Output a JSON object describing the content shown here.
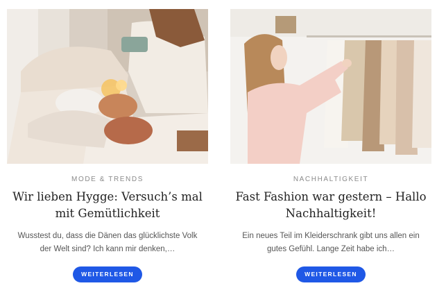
{
  "posts": [
    {
      "category": "Mode & Trends",
      "title": "Wir lieben Hygge: Versuch’s mal mit Gemütlichkeit",
      "excerpt": "Wusstest du, dass die Dänen das glücklichste Volk der Welt sind? Ich kann mir denken,…",
      "button": "Weiterlesen"
    },
    {
      "category": "Nachhaltigkeit",
      "title": "Fast Fashion war gestern – Hallo Nachhaltigkeit!",
      "excerpt": "Ein neues Teil im Kleiderschrank gibt uns allen ein gutes Gefühl. Lange Zeit habe ich…",
      "button": "Weiterlesen"
    }
  ],
  "colors": {
    "button": "#1f58e6",
    "category": "#8a8a8a",
    "title": "#222222"
  }
}
